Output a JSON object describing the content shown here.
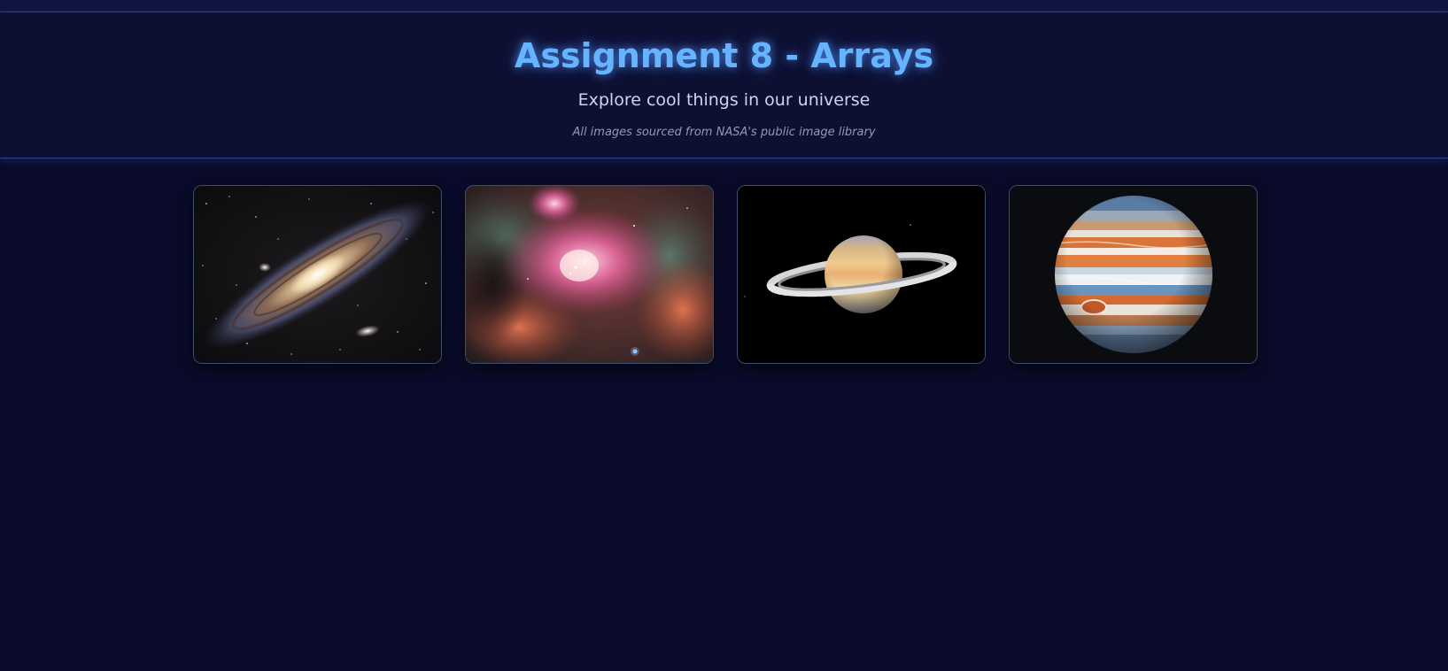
{
  "header": {
    "title": "Assignment 8 - Arrays",
    "subtitle": "Explore cool things in our universe",
    "credit": "All images sourced from NASA's public image library"
  },
  "gallery": {
    "images": [
      {
        "subject": "andromeda-galaxy-image"
      },
      {
        "subject": "orion-nebula-image"
      },
      {
        "subject": "saturn-image"
      },
      {
        "subject": "jupiter-image"
      }
    ]
  },
  "colors": {
    "background": "#0a0b2a",
    "header_background": "#0e1032",
    "title": "#66b3ff",
    "subtitle": "#c8d6f5",
    "credit": "#8f9bb6",
    "card_border": "#3a4f72"
  }
}
